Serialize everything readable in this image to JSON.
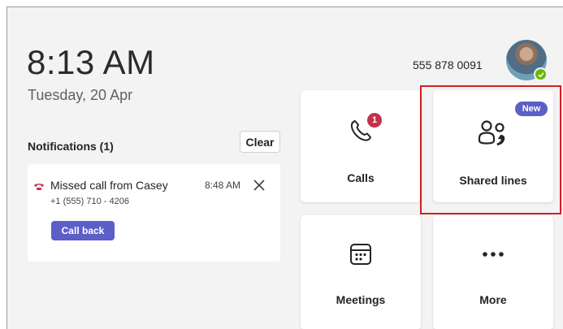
{
  "header": {
    "time": "8:13 AM",
    "date": "Tuesday, 20 Apr",
    "phone_number": "555 878 0091",
    "presence": "available"
  },
  "notifications": {
    "title": "Notifications (1)",
    "clear_label": "Clear",
    "items": [
      {
        "text": "Missed call from Casey",
        "number": "+1 (555) 710 - 4206",
        "time": "8:48 AM",
        "action_label": "Call back"
      }
    ]
  },
  "tiles": {
    "calls": {
      "label": "Calls",
      "icon": "phone-icon",
      "badge": "1"
    },
    "shared_lines": {
      "label": "Shared lines",
      "icon": "shared-lines-icon",
      "badge": "New"
    },
    "meetings": {
      "label": "Meetings",
      "icon": "calendar-icon"
    },
    "more": {
      "label": "More",
      "icon": "ellipsis-icon"
    }
  },
  "colors": {
    "accent": "#5b5fc7",
    "alert": "#c4314b",
    "presence": "#6bb700",
    "highlight": "#d32020"
  }
}
